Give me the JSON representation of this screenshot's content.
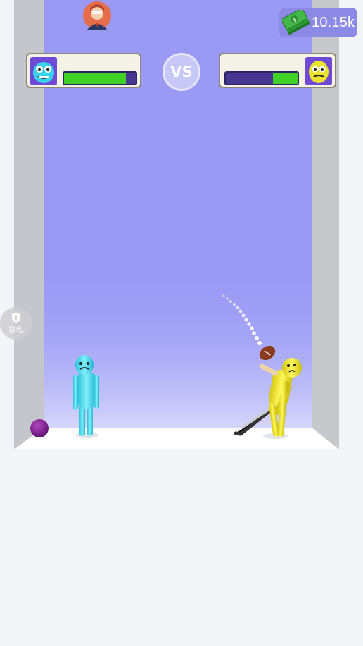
{
  "hud": {
    "money_amount": "10.15k",
    "vs_label": "VS"
  },
  "players": {
    "left": {
      "color": "#3bd6e8",
      "health": 0.86
    },
    "right": {
      "color": "#e8e02a",
      "health": 0.34
    }
  },
  "privacy_button": {
    "label": "隐私"
  },
  "colors": {
    "arena_back": "#9a9af5",
    "floor": "#ffffff",
    "side_walls": "#c7c8cc",
    "health_fill": "#3fd125",
    "health_track": "#473694",
    "ball": "#7a1b8a"
  },
  "icons": {
    "money": "cash-stack-icon",
    "privacy": "shield-icon",
    "opponent_avatar": "avatar-icon"
  }
}
